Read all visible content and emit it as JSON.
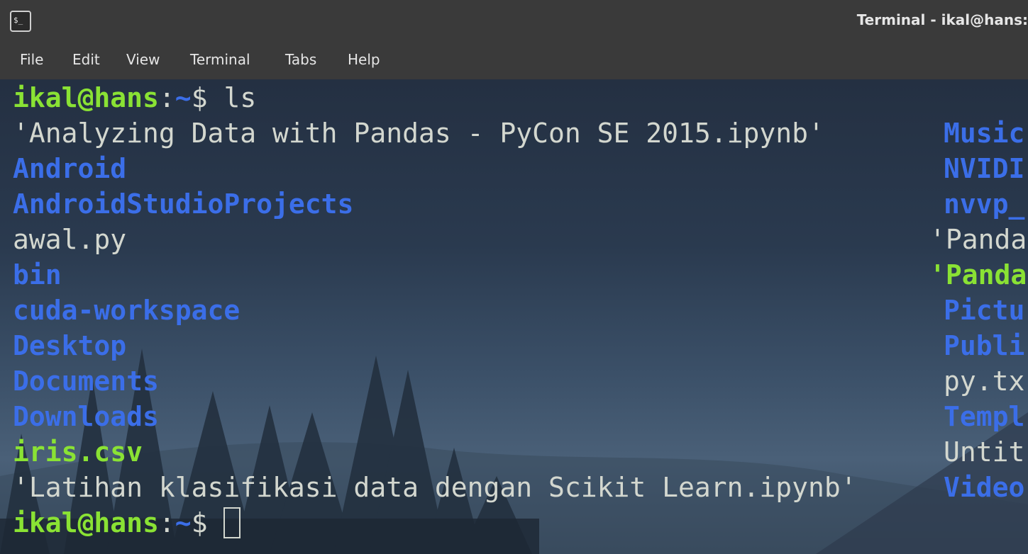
{
  "window": {
    "title": "Terminal - ikal@hans:"
  },
  "menu": [
    "File",
    "Edit",
    "View",
    "Terminal",
    "Tabs",
    "Help"
  ],
  "prompt": {
    "user": "ikal@hans",
    "sep": ":",
    "path": "~",
    "symbol": "$"
  },
  "command": "ls",
  "left_column": [
    "'Analyzing Data with Pandas - PyCon SE 2015.ipynb'",
    "Android",
    "AndroidStudioProjects",
    "awal.py",
    "bin",
    "cuda-workspace",
    "Desktop",
    "Documents",
    "Downloads",
    "iris.csv",
    "'Latihan klasifikasi data dengan Scikit Learn.ipynb'"
  ],
  "right_column": [
    "Music",
    "NVIDI",
    "nvvp_",
    "'Panda",
    "'Panda",
    "Pictu",
    "Publi",
    "py.tx",
    "Templ",
    "Untit",
    "Video"
  ],
  "colors": {
    "directory": "#3b6ee8",
    "executable": "#8ae234",
    "file": "#d3d7cf",
    "chrome": "#3a3a3a"
  }
}
